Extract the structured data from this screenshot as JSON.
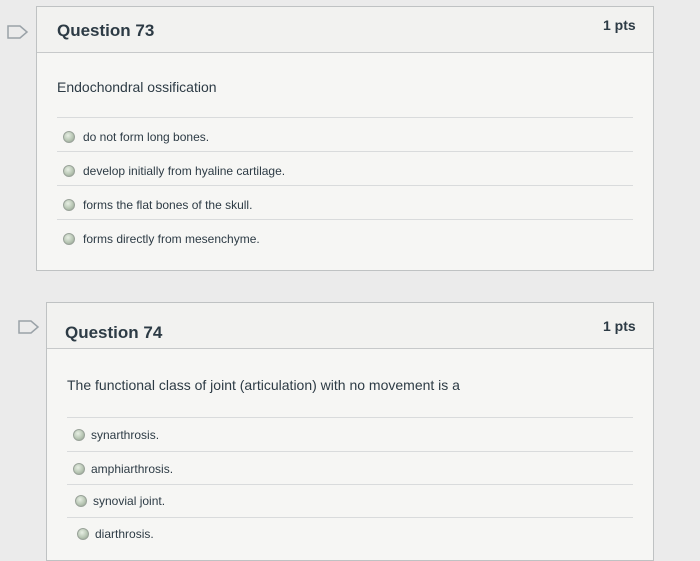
{
  "questions": [
    {
      "title": "Question 73",
      "points": "1 pts",
      "prompt": "Endochondral ossification",
      "answers": [
        "do not form long bones.",
        "develop initially from hyaline cartilage.",
        "forms the flat bones of the skull.",
        "forms directly from mesenchyme."
      ]
    },
    {
      "title": "Question 74",
      "points": "1 pts",
      "prompt": "The functional class of joint (articulation) with no movement is a",
      "answers": [
        "synarthrosis.",
        "amphiarthrosis.",
        "synovial joint.",
        "diarthrosis."
      ]
    }
  ]
}
